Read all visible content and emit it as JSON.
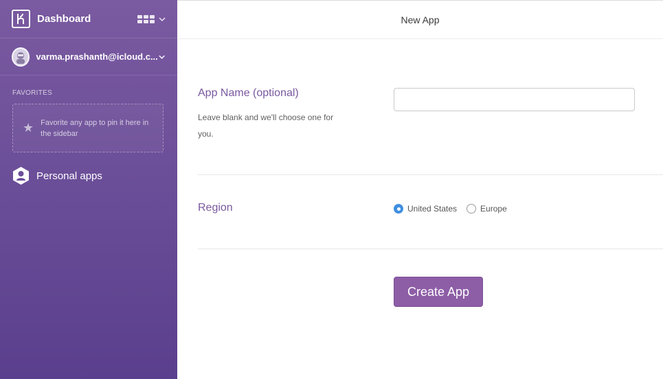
{
  "sidebar": {
    "brand": "Dashboard",
    "account_email": "varma.prashanth@icloud.c...",
    "favorites_title": "FAVORITES",
    "favorites_hint": "Favorite any app to pin it here in the sidebar",
    "personal_apps": "Personal apps",
    "icons": [
      "heroku-logo-icon",
      "apps-grid-icon",
      "chevron-down-icon",
      "avatar",
      "star-icon",
      "person-hexagon-icon"
    ]
  },
  "header": {
    "title": "New App"
  },
  "form": {
    "app_name_label": "App Name (optional)",
    "app_name_help": "Leave blank and we'll choose one for you.",
    "app_name_value": "",
    "region_label": "Region",
    "regions": [
      "United States",
      "Europe"
    ],
    "selected_region": "United States",
    "submit_label": "Create App"
  },
  "colors": {
    "sidebar": "#6c4f99",
    "accent": "#79589f",
    "button": "#8d5da6",
    "radio": "#3f8fe0"
  }
}
